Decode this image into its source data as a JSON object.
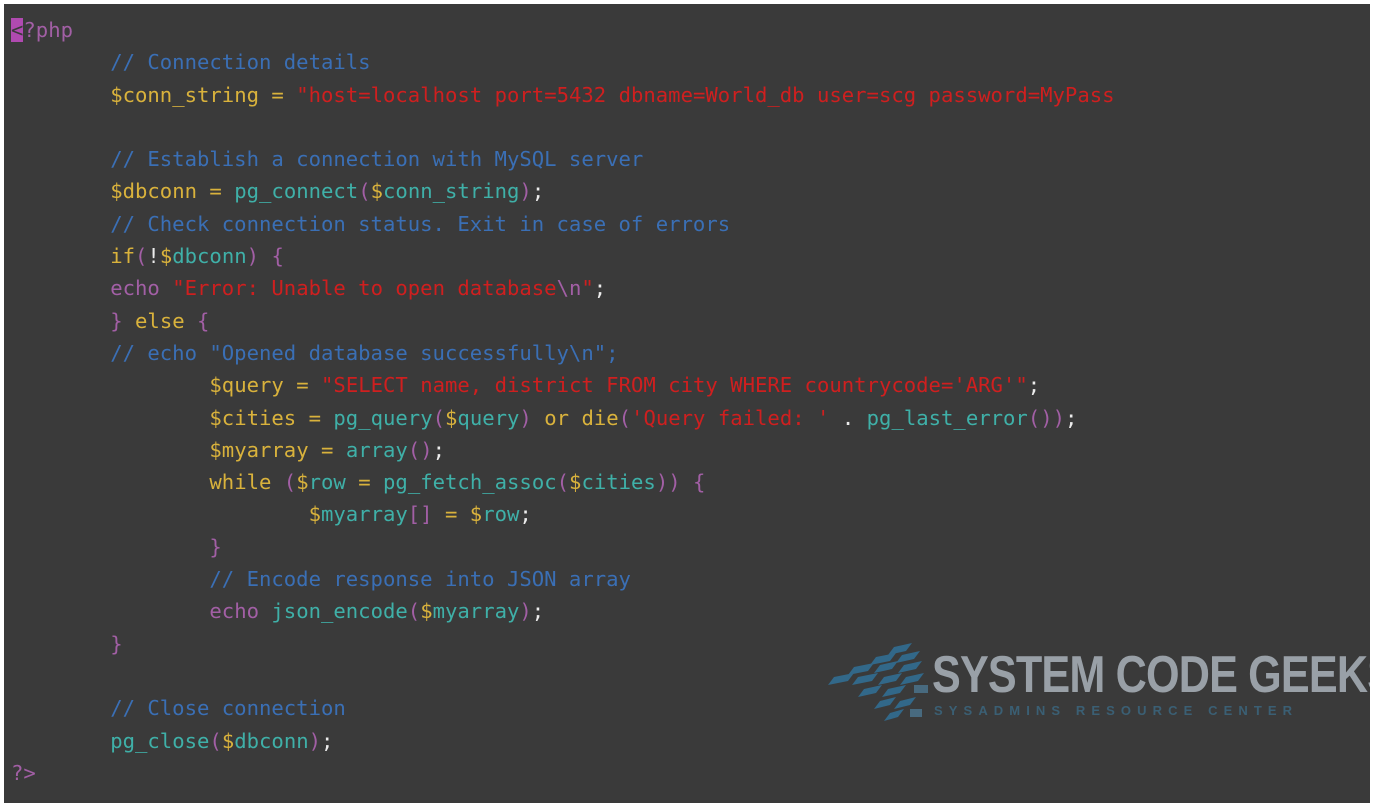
{
  "code_lines": [
    [
      {
        "t": "<",
        "c": "cursor"
      },
      {
        "t": "?php",
        "c": "t-meta"
      }
    ],
    [
      {
        "t": "        // Connection details",
        "c": "t-comment"
      }
    ],
    [
      {
        "t": "        ",
        "c": "t-white"
      },
      {
        "t": "$",
        "c": "t-var"
      },
      {
        "t": "conn_string ",
        "c": "t-var"
      },
      {
        "t": "= ",
        "c": "t-op"
      },
      {
        "t": "\"host=localhost port=5432 dbname=World_db user=scg password=MyPass",
        "c": "t-str"
      }
    ],
    [
      {
        "t": "",
        "c": "t-white"
      }
    ],
    [
      {
        "t": "        // Establish a connection with MySQL server",
        "c": "t-comment"
      }
    ],
    [
      {
        "t": "        ",
        "c": "t-white"
      },
      {
        "t": "$",
        "c": "t-var"
      },
      {
        "t": "dbconn ",
        "c": "t-var"
      },
      {
        "t": "= ",
        "c": "t-op"
      },
      {
        "t": "pg_connect",
        "c": "t-fn"
      },
      {
        "t": "(",
        "c": "t-brace"
      },
      {
        "t": "$",
        "c": "t-var"
      },
      {
        "t": "conn_string",
        "c": "t-fn"
      },
      {
        "t": ")",
        "c": "t-brace"
      },
      {
        "t": ";",
        "c": "t-white"
      }
    ],
    [
      {
        "t": "        // Check connection status. Exit in case of errors",
        "c": "t-comment"
      }
    ],
    [
      {
        "t": "        ",
        "c": "t-white"
      },
      {
        "t": "if",
        "c": "t-key"
      },
      {
        "t": "(",
        "c": "t-brace"
      },
      {
        "t": "!",
        "c": "t-white"
      },
      {
        "t": "$",
        "c": "t-var"
      },
      {
        "t": "dbconn",
        "c": "t-fn"
      },
      {
        "t": ") {",
        "c": "t-brace"
      }
    ],
    [
      {
        "t": "        ",
        "c": "t-white"
      },
      {
        "t": "echo ",
        "c": "t-echo"
      },
      {
        "t": "\"Error: Unable to open database",
        "c": "t-str"
      },
      {
        "t": "\\n",
        "c": "t-esc"
      },
      {
        "t": "\"",
        "c": "t-str"
      },
      {
        "t": ";",
        "c": "t-white"
      }
    ],
    [
      {
        "t": "        ",
        "c": "t-white"
      },
      {
        "t": "} ",
        "c": "t-brace"
      },
      {
        "t": "else",
        "c": "t-key"
      },
      {
        "t": " {",
        "c": "t-brace"
      }
    ],
    [
      {
        "t": "        // echo \"Opened database successfully\\n\";",
        "c": "t-comment"
      }
    ],
    [
      {
        "t": "                ",
        "c": "t-white"
      },
      {
        "t": "$",
        "c": "t-var"
      },
      {
        "t": "query ",
        "c": "t-var"
      },
      {
        "t": "= ",
        "c": "t-op"
      },
      {
        "t": "\"SELECT name, district FROM city WHERE countrycode='ARG'",
        "c": "t-str"
      },
      {
        "t": "\"",
        "c": "t-str"
      },
      {
        "t": ";",
        "c": "t-white"
      }
    ],
    [
      {
        "t": "                ",
        "c": "t-white"
      },
      {
        "t": "$",
        "c": "t-var"
      },
      {
        "t": "cities ",
        "c": "t-var"
      },
      {
        "t": "= ",
        "c": "t-op"
      },
      {
        "t": "pg_query",
        "c": "t-fn"
      },
      {
        "t": "(",
        "c": "t-brace"
      },
      {
        "t": "$",
        "c": "t-var"
      },
      {
        "t": "query",
        "c": "t-fn"
      },
      {
        "t": ") ",
        "c": "t-brace"
      },
      {
        "t": "or ",
        "c": "t-key"
      },
      {
        "t": "die",
        "c": "t-key"
      },
      {
        "t": "(",
        "c": "t-brace"
      },
      {
        "t": "'Query failed: ' ",
        "c": "t-str"
      },
      {
        "t": ". ",
        "c": "t-white"
      },
      {
        "t": "pg_last_error",
        "c": "t-fn"
      },
      {
        "t": "())",
        "c": "t-brace"
      },
      {
        "t": ";",
        "c": "t-white"
      }
    ],
    [
      {
        "t": "                ",
        "c": "t-white"
      },
      {
        "t": "$",
        "c": "t-var"
      },
      {
        "t": "myarray ",
        "c": "t-var"
      },
      {
        "t": "= ",
        "c": "t-op"
      },
      {
        "t": "array",
        "c": "t-fn"
      },
      {
        "t": "()",
        "c": "t-brace"
      },
      {
        "t": ";",
        "c": "t-white"
      }
    ],
    [
      {
        "t": "                ",
        "c": "t-white"
      },
      {
        "t": "while ",
        "c": "t-key"
      },
      {
        "t": "(",
        "c": "t-brace"
      },
      {
        "t": "$",
        "c": "t-var"
      },
      {
        "t": "row ",
        "c": "t-fn"
      },
      {
        "t": "= ",
        "c": "t-op"
      },
      {
        "t": "pg_fetch_assoc",
        "c": "t-fn"
      },
      {
        "t": "(",
        "c": "t-brace"
      },
      {
        "t": "$",
        "c": "t-var"
      },
      {
        "t": "cities",
        "c": "t-fn"
      },
      {
        "t": ")) {",
        "c": "t-brace"
      }
    ],
    [
      {
        "t": "                        ",
        "c": "t-white"
      },
      {
        "t": "$",
        "c": "t-var"
      },
      {
        "t": "myarray",
        "c": "t-fn"
      },
      {
        "t": "[] ",
        "c": "t-brace"
      },
      {
        "t": "= ",
        "c": "t-op"
      },
      {
        "t": "$",
        "c": "t-var"
      },
      {
        "t": "row",
        "c": "t-fn"
      },
      {
        "t": ";",
        "c": "t-white"
      }
    ],
    [
      {
        "t": "                ",
        "c": "t-white"
      },
      {
        "t": "}",
        "c": "t-brace"
      }
    ],
    [
      {
        "t": "                // Encode response into JSON array",
        "c": "t-comment"
      }
    ],
    [
      {
        "t": "                ",
        "c": "t-white"
      },
      {
        "t": "echo ",
        "c": "t-echo"
      },
      {
        "t": "json_encode",
        "c": "t-fn"
      },
      {
        "t": "(",
        "c": "t-brace"
      },
      {
        "t": "$",
        "c": "t-var"
      },
      {
        "t": "myarray",
        "c": "t-fn"
      },
      {
        "t": ")",
        "c": "t-brace"
      },
      {
        "t": ";",
        "c": "t-white"
      }
    ],
    [
      {
        "t": "        ",
        "c": "t-white"
      },
      {
        "t": "}",
        "c": "t-brace"
      }
    ],
    [
      {
        "t": "",
        "c": "t-white"
      }
    ],
    [
      {
        "t": "        // Close connection",
        "c": "t-comment"
      }
    ],
    [
      {
        "t": "        ",
        "c": "t-white"
      },
      {
        "t": "pg_close",
        "c": "t-fn"
      },
      {
        "t": "(",
        "c": "t-brace"
      },
      {
        "t": "$",
        "c": "t-var"
      },
      {
        "t": "dbconn",
        "c": "t-fn"
      },
      {
        "t": ")",
        "c": "t-brace"
      },
      {
        "t": ";",
        "c": "t-white"
      }
    ],
    [
      {
        "t": "?>",
        "c": "t-meta"
      }
    ]
  ],
  "watermark": {
    "title": "SYSTEM CODE GEEKS",
    "subtitle": "SYSADMINS RESOURCE CENTER"
  }
}
